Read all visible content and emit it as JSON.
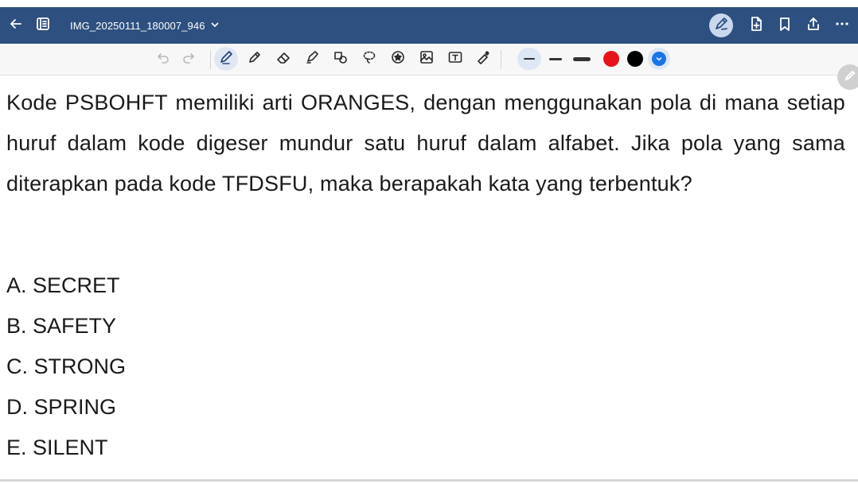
{
  "titlebar": {
    "title": "IMG_20250111_180007_946",
    "background": "#2d5080",
    "icons": [
      "back-arrow-icon",
      "sidebar-icon",
      "chevron-down-icon",
      "pen-tablet-icon",
      "add-page-icon",
      "bookmark-icon",
      "share-icon",
      "more-icon"
    ]
  },
  "toolbar": {
    "tools": [
      "undo-icon",
      "redo-icon",
      "pen-icon",
      "pencil-icon",
      "eraser-icon",
      "highlighter-icon",
      "shapes-icon",
      "lasso-icon",
      "sticker-icon",
      "image-icon",
      "text-box-icon",
      "laser-pointer-icon"
    ],
    "active_tool": "pen-icon",
    "stroke_widths": [
      "thin",
      "medium",
      "thick"
    ],
    "selected_stroke": "thin",
    "colors": [
      "#e8141a",
      "#000000",
      "#1a73e8"
    ],
    "selected_color": "#1a73e8"
  },
  "content": {
    "question": "Kode PSBOHFT memiliki arti ORANGES, dengan menggunakan pola di mana setiap huruf dalam kode digeser mundur satu huruf dalam alfabet. Jika pola yang sama diterapkan pada kode TFDSFU, maka berapakah kata yang terbentuk?",
    "options": [
      "A. SECRET",
      "B. SAFETY",
      "C. STRONG",
      "D. SPRING",
      "E. SILENT"
    ]
  }
}
